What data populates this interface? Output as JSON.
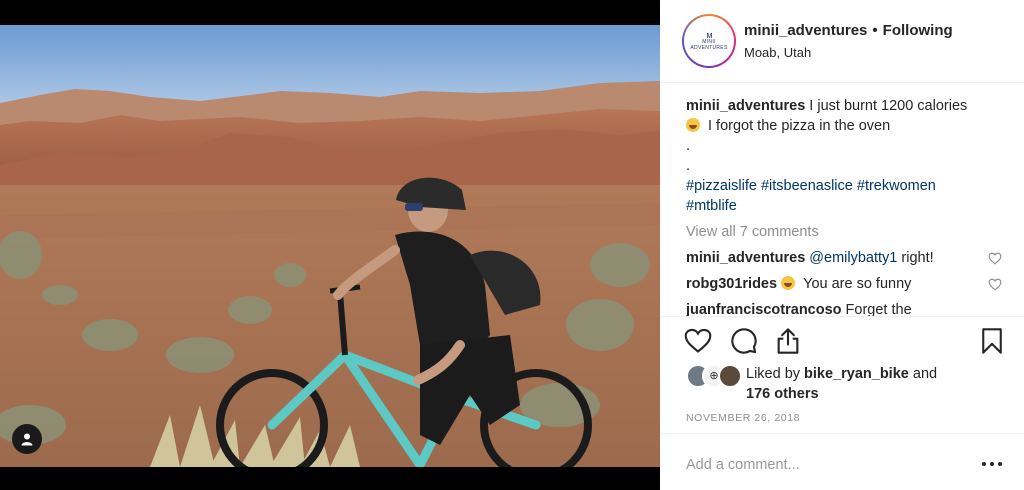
{
  "post": {
    "username": "minii_adventures",
    "separator": "•",
    "follow_status": "Following",
    "location": "Moab, Utah",
    "avatar_brand_text": "MINII ADVENTURES",
    "avatar_mark": "ᴍ"
  },
  "caption": {
    "username": "minii_adventures",
    "text_part1": "I just burnt 1200 calories",
    "text_part2": "I forgot the pizza in the oven",
    "dot1": ".",
    "dot2": ".",
    "hashtags": [
      "#pizzaislife",
      "#itsbeenaslice",
      "#trekwomen",
      "#mtblife"
    ]
  },
  "view_all_comments": "View all 7 comments",
  "comments": [
    {
      "username": "minii_adventures",
      "mention": "@emilybatty1",
      "text": "right!"
    },
    {
      "username": "robg301rides",
      "text": "You are so funny"
    },
    {
      "username": "juanfranciscotrancoso",
      "text": "Forget the"
    }
  ],
  "likes": {
    "prefix": "Liked by",
    "user": "bike_ryan_bike",
    "conj": "and",
    "others": "176 others",
    "avatar_mid_text": "⊕"
  },
  "date": "NOVEMBER 26, 2018",
  "add_comment_placeholder": "Add a comment...",
  "icons": {
    "like": "heart-icon",
    "comment": "comment-bubble-icon",
    "share": "share-icon",
    "save": "bookmark-icon",
    "more": "more-options-icon",
    "user_tag": "user-tag-icon"
  },
  "colors": {
    "link": "#003569",
    "muted": "#8e8e8e",
    "text": "#262626",
    "divider": "#efefef"
  }
}
